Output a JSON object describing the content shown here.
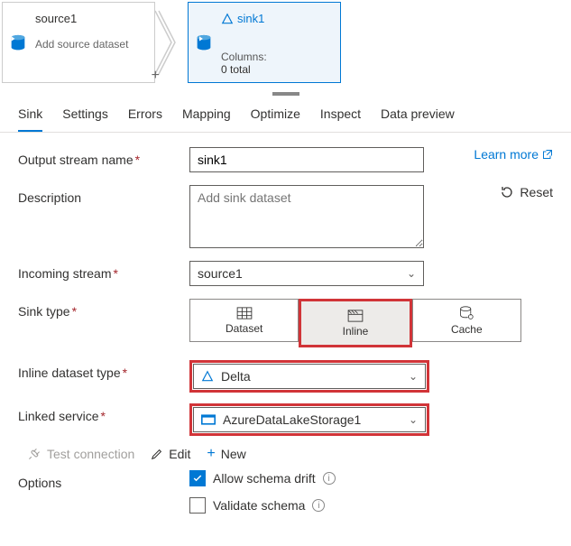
{
  "flow": {
    "source": {
      "title": "source1",
      "sub": "Add source dataset"
    },
    "sink": {
      "title": "sink1",
      "cols_label": "Columns:",
      "cols_value": "0 total"
    }
  },
  "tabs": [
    "Sink",
    "Settings",
    "Errors",
    "Mapping",
    "Optimize",
    "Inspect",
    "Data preview"
  ],
  "learn_more": "Learn more",
  "reset": "Reset",
  "form": {
    "output_stream_label": "Output stream name",
    "output_stream_value": "sink1",
    "description_label": "Description",
    "description_placeholder": "Add sink dataset",
    "incoming_label": "Incoming stream",
    "incoming_value": "source1",
    "sink_type_label": "Sink type",
    "sink_types": [
      "Dataset",
      "Inline",
      "Cache"
    ],
    "inline_type_label": "Inline dataset type",
    "inline_type_value": "Delta",
    "linked_service_label": "Linked service",
    "linked_service_value": "AzureDataLakeStorage1",
    "test_connection": "Test connection",
    "edit": "Edit",
    "new": "New",
    "options_label": "Options",
    "allow_drift": "Allow schema drift",
    "validate_schema": "Validate schema"
  }
}
